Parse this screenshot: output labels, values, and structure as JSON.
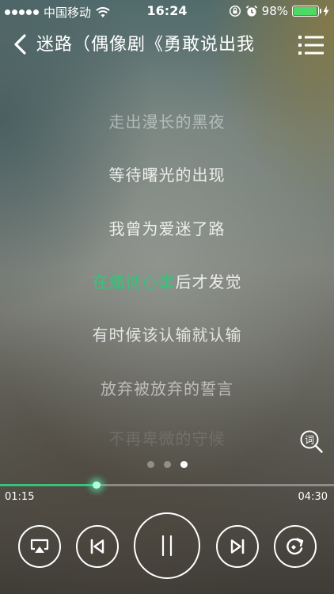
{
  "status_bar": {
    "carrier": "中国移动",
    "time": "16:24",
    "battery": "98%",
    "battery_level": 0.98
  },
  "header": {
    "title": "迷路（偶像剧《勇敢说出我"
  },
  "lyrics": {
    "line1": "走出漫长的黑夜",
    "line2": "等待曙光的出现",
    "line3": "我曾为爱迷了路",
    "line4_sung": "在痛彻心扉",
    "line4_rest": "后才发觉",
    "line5": "有时候该认输就认输",
    "line6": "放弃被放弃的誓言",
    "line7": "不再卑微的守候"
  },
  "lyric_search_label": "词",
  "pager": {
    "pages": 3,
    "active": 3
  },
  "playback": {
    "elapsed": "01:15",
    "total": "04:30",
    "progress": 0.29
  },
  "colors": {
    "accent": "#34c47c",
    "battery_green": "#4cd964"
  }
}
